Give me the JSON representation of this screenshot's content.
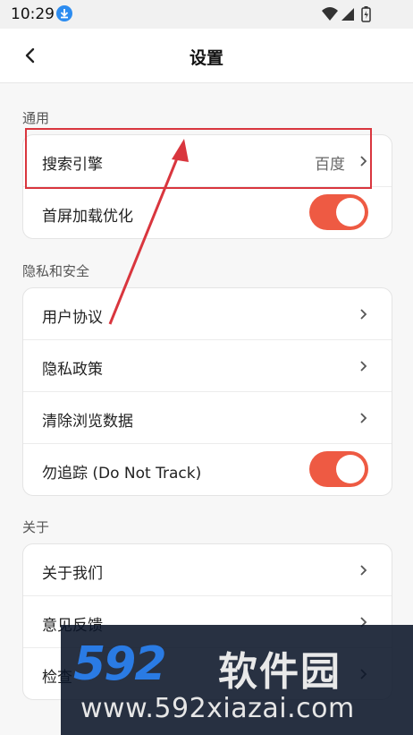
{
  "status_bar": {
    "time": "10:29",
    "icons": [
      "download-icon",
      "wifi-icon",
      "signal-icon",
      "battery-icon"
    ]
  },
  "header": {
    "title": "设置",
    "back_icon": "chevron-left-icon"
  },
  "sections": {
    "general": {
      "label": "通用",
      "items": [
        {
          "label": "搜索引擎",
          "value": "百度"
        },
        {
          "label": "首屏加载优化",
          "toggle": true
        }
      ]
    },
    "privacy": {
      "label": "隐私和安全",
      "items": [
        {
          "label": "用户协议"
        },
        {
          "label": "隐私政策"
        },
        {
          "label": "清除浏览数据"
        },
        {
          "label": "勿追踪 (Do Not Track)",
          "toggle": true
        }
      ]
    },
    "about": {
      "label": "关于",
      "items": [
        {
          "label": "关于我们"
        },
        {
          "label": "意见反馈"
        },
        {
          "label": "检查"
        }
      ]
    }
  },
  "watermark": {
    "logo_number": "592",
    "logo_text": "软件园",
    "url": "www.592xiazai.com"
  },
  "colors": {
    "accent_toggle": "#ee5a43",
    "annotation_red": "#d9363e",
    "watermark_blue": "#2a7be4"
  }
}
